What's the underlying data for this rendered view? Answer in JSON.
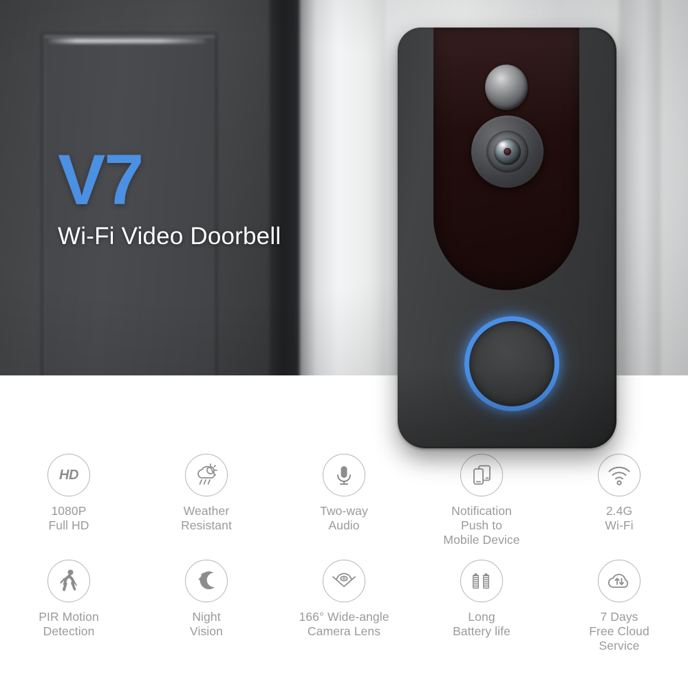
{
  "hero": {
    "brand": "V7",
    "tagline": "Wi-Fi Video Doorbell",
    "brand_color": "#4b90e2",
    "tagline_color": "#ffffff",
    "background_description": "blurred dark gray front door with white door frame"
  },
  "product": {
    "name": "video-doorbell",
    "body_color": "#3a3b3c",
    "faceplate_color": "#220e0e",
    "button_ring_color": "#4a8fe7",
    "parts": [
      "pir-sensor-dome",
      "camera-lens",
      "doorbell-button"
    ]
  },
  "features": {
    "icon_color": "#8d8d8d",
    "circle_border_color": "#b4b4b4",
    "label_color": "#9a9a9a",
    "row1": [
      {
        "icon": "hd-badge-icon",
        "icon_text": "HD",
        "label": "1080P\nFull HD"
      },
      {
        "icon": "sun-cloud-rain-icon",
        "label": "Weather\nResistant"
      },
      {
        "icon": "microphone-icon",
        "label": "Two-way\nAudio"
      },
      {
        "icon": "mobile-devices-icon",
        "label": "Notification\nPush to\nMobile Device"
      },
      {
        "icon": "wifi-signal-icon",
        "label": "2.4G\nWi-Fi"
      }
    ],
    "row2": [
      {
        "icon": "walking-person-icon",
        "label": "PIR Motion\nDetection"
      },
      {
        "icon": "moon-stars-icon",
        "label": "Night\nVision"
      },
      {
        "icon": "wide-angle-lens-icon",
        "label": "166° Wide-angle\nCamera Lens"
      },
      {
        "icon": "battery-pair-icon",
        "label": "Long\nBattery life"
      },
      {
        "icon": "cloud-sync-icon",
        "label": "7 Days\nFree Cloud\nService"
      }
    ]
  }
}
